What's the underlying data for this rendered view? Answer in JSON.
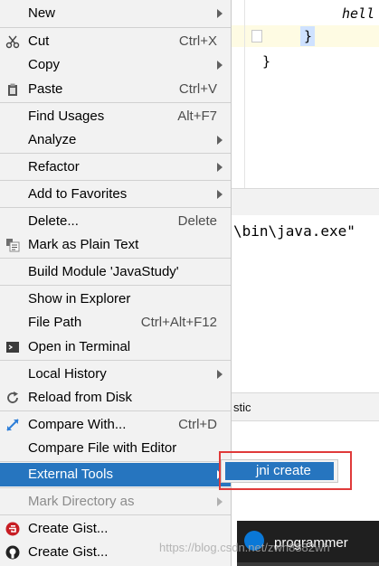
{
  "editor": {
    "code_line1": "hell",
    "code_line2": "}",
    "code_line3": "}"
  },
  "console": {
    "text": "\\bin\\java.exe\""
  },
  "tab_bar": {
    "fragment": "stic"
  },
  "taskbar": {
    "label": "programmer"
  },
  "watermark": "https://blog.csdn.net/zwh8882wh",
  "menu": {
    "new": {
      "label": "New"
    },
    "cut": {
      "label": "Cut",
      "shortcut": "Ctrl+X",
      "icon": "scissors-icon"
    },
    "copy": {
      "label": "Copy"
    },
    "paste": {
      "label": "Paste",
      "shortcut": "Ctrl+V",
      "icon": "clipboard-icon"
    },
    "find_usages": {
      "label": "Find Usages",
      "shortcut": "Alt+F7"
    },
    "analyze": {
      "label": "Analyze"
    },
    "refactor": {
      "label": "Refactor"
    },
    "add_favorites": {
      "label": "Add to Favorites"
    },
    "delete": {
      "label": "Delete...",
      "shortcut": "Delete"
    },
    "mark_plain": {
      "label": "Mark as Plain Text",
      "icon": "text-file-icon"
    },
    "build_module": {
      "label": "Build Module 'JavaStudy'"
    },
    "show_explorer": {
      "label": "Show in Explorer"
    },
    "file_path": {
      "label": "File Path",
      "shortcut": "Ctrl+Alt+F12"
    },
    "open_terminal": {
      "label": "Open in Terminal",
      "icon": "terminal-icon"
    },
    "local_history": {
      "label": "Local History"
    },
    "reload_disk": {
      "label": "Reload from Disk",
      "icon": "reload-icon"
    },
    "compare_with": {
      "label": "Compare With...",
      "shortcut": "Ctrl+D",
      "icon": "compare-arrows-icon"
    },
    "compare_editor": {
      "label": "Compare File with Editor"
    },
    "external_tools": {
      "label": "External Tools"
    },
    "mark_directory": {
      "label": "Mark Directory as"
    },
    "create_gist_1": {
      "label": "Create Gist...",
      "icon": "gitee-icon"
    },
    "create_gist_2": {
      "label": "Create Gist...",
      "icon": "github-icon"
    }
  },
  "submenu": {
    "jni_create": "jni create"
  },
  "colors": {
    "selection": "#2675bf",
    "menu_bg": "#f2f2f2",
    "highlight_box": "#e03a3a"
  }
}
